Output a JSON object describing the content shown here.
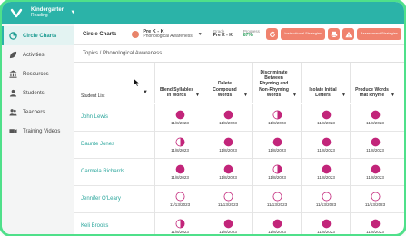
{
  "app": {
    "program": "Kindergarten",
    "subject": "Reading",
    "accent": "#2bb3a8"
  },
  "sidebar": {
    "items": [
      {
        "label": "Circle Charts",
        "icon": "circle-chart-icon",
        "active": true
      },
      {
        "label": "Activities",
        "icon": "leaf-icon",
        "active": false
      },
      {
        "label": "Resources",
        "icon": "bank-icon",
        "active": false
      },
      {
        "label": "Students",
        "icon": "students-icon",
        "active": false
      },
      {
        "label": "Teachers",
        "icon": "teachers-icon",
        "active": false
      },
      {
        "label": "Training Videos",
        "icon": "video-icon",
        "active": false
      }
    ]
  },
  "header": {
    "title": "Circle Charts",
    "filter_level": "Pre K - K",
    "filter_topic": "Phonological Awareness",
    "grade_label": "Grade",
    "grade_value": "Pre K - K",
    "progress_label": "Progress",
    "progress_value": "87%",
    "btn_instructional": "Instructional Strategies",
    "btn_assessment": "Assessment Strategies",
    "progress_color": "#2a9e5b",
    "button_color": "#f0826e"
  },
  "breadcrumb": "Topics / Phonological Awareness",
  "table": {
    "student_header": "Student List",
    "filled_color": "#c2257a",
    "columns": [
      "Blend Syllables in Words",
      "Delete Compound Words",
      "Discriminate Between Rhyming and Non-Rhyming Words",
      "Isolate Initial Letters",
      "Produce Words that Rhyme"
    ],
    "rows": [
      {
        "name": "John Lewis",
        "cells": [
          {
            "fill": "full",
            "date": "11/8/2023"
          },
          {
            "fill": "full",
            "date": "11/8/2023"
          },
          {
            "fill": "half",
            "date": "11/8/2023"
          },
          {
            "fill": "full",
            "date": "11/8/2023"
          },
          {
            "fill": "full",
            "date": "11/8/2023"
          }
        ]
      },
      {
        "name": "Daunte Jones",
        "cells": [
          {
            "fill": "half",
            "date": "11/8/2023"
          },
          {
            "fill": "full",
            "date": "11/8/2023"
          },
          {
            "fill": "full",
            "date": "11/8/2023"
          },
          {
            "fill": "full",
            "date": "11/8/2023"
          },
          {
            "fill": "full",
            "date": "11/8/2023"
          }
        ]
      },
      {
        "name": "Carmela Richards",
        "cells": [
          {
            "fill": "full",
            "date": "11/8/2023"
          },
          {
            "fill": "full",
            "date": "11/8/2023"
          },
          {
            "fill": "half",
            "date": "11/8/2023"
          },
          {
            "fill": "full",
            "date": "11/8/2023"
          },
          {
            "fill": "full",
            "date": "11/8/2023"
          }
        ]
      },
      {
        "name": "Jennifer O'Leary",
        "cells": [
          {
            "fill": "empty",
            "date": "11/13/2023"
          },
          {
            "fill": "empty",
            "date": "11/13/2023"
          },
          {
            "fill": "empty",
            "date": "11/13/2023"
          },
          {
            "fill": "empty",
            "date": "11/13/2023"
          },
          {
            "fill": "empty",
            "date": "11/13/2023"
          }
        ]
      },
      {
        "name": "Keli Brooks",
        "cells": [
          {
            "fill": "half",
            "date": "11/8/2023"
          },
          {
            "fill": "full",
            "date": "11/8/2023"
          },
          {
            "fill": "full",
            "date": "11/8/2023"
          },
          {
            "fill": "full",
            "date": "11/8/2023"
          },
          {
            "fill": "full",
            "date": "11/8/2023"
          }
        ]
      }
    ]
  }
}
